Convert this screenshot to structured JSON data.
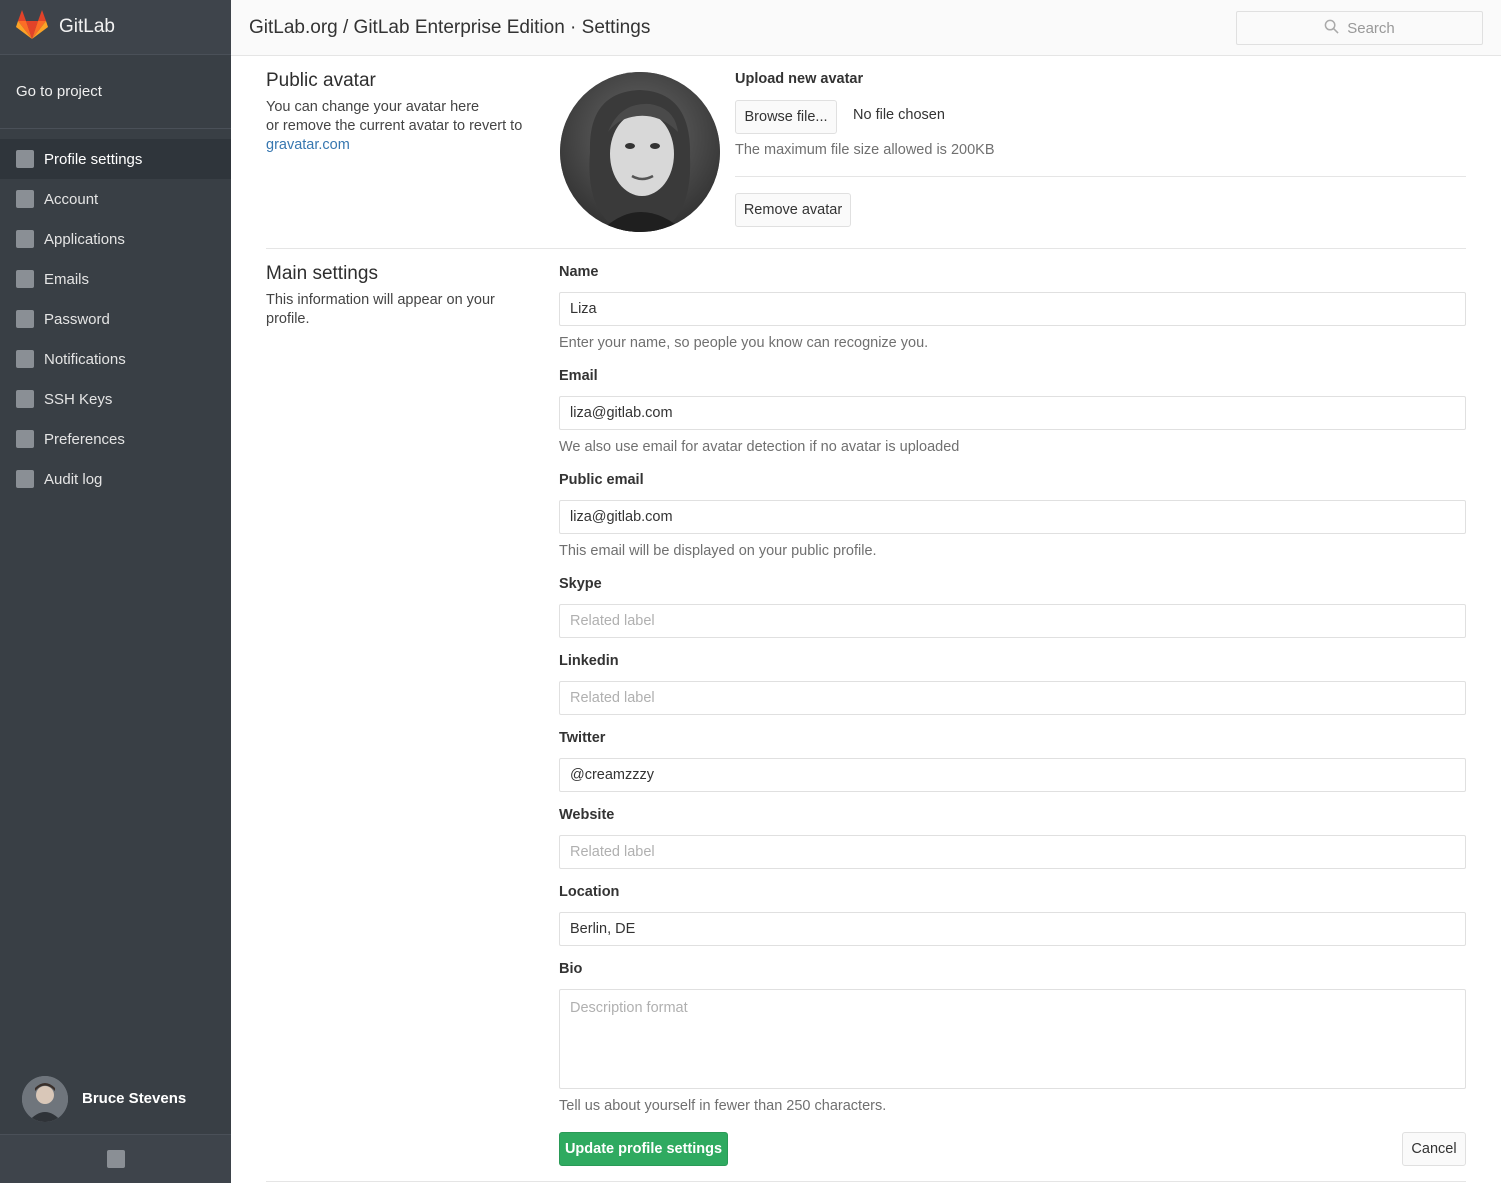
{
  "brand": {
    "name": "GitLab",
    "logo_icon": "gitlab-tanuki-icon"
  },
  "sidebar": {
    "go_to_project": "Go to project",
    "items": [
      {
        "label": "Profile settings",
        "active": true
      },
      {
        "label": "Account"
      },
      {
        "label": "Applications"
      },
      {
        "label": "Emails"
      },
      {
        "label": "Password"
      },
      {
        "label": "Notifications"
      },
      {
        "label": "SSH Keys"
      },
      {
        "label": "Preferences"
      },
      {
        "label": "Audit log"
      }
    ],
    "user": {
      "name": "Bruce Stevens"
    }
  },
  "header": {
    "title": "GitLab.org / GitLab Enterprise Edition · Settings",
    "search_placeholder": "Search"
  },
  "avatar_section": {
    "title": "Public avatar",
    "desc_line1": "You can change your avatar here",
    "desc_line2": "or remove the current avatar to revert to",
    "link": "gravatar.com",
    "upload_label": "Upload new avatar",
    "browse_button": "Browse file...",
    "no_file": "No file chosen",
    "max_size": "The maximum file size allowed is 200KB",
    "remove_button": "Remove avatar"
  },
  "main_section": {
    "title": "Main settings",
    "desc_line1": "This information will appear on your",
    "desc_line2": "profile.",
    "fields": {
      "name": {
        "label": "Name",
        "value": "Liza",
        "help": "Enter your name, so people you know can recognize you."
      },
      "email": {
        "label": "Email",
        "value": "liza@gitlab.com",
        "help": "We also use email for avatar detection if no avatar is uploaded"
      },
      "public_email": {
        "label": "Public email",
        "value": "liza@gitlab.com",
        "help": "This email will be displayed on your public profile."
      },
      "skype": {
        "label": "Skype",
        "value": "",
        "placeholder": "Related label"
      },
      "linkedin": {
        "label": "Linkedin",
        "value": "",
        "placeholder": "Related label"
      },
      "twitter": {
        "label": "Twitter",
        "value": "@creamzzzy"
      },
      "website": {
        "label": "Website",
        "value": "",
        "placeholder": "Related label"
      },
      "location": {
        "label": "Location",
        "value": "Berlin, DE"
      },
      "bio": {
        "label": "Bio",
        "value": "",
        "placeholder": "Description format",
        "help": "Tell us about yourself in fewer than 250 characters."
      }
    },
    "update_button": "Update profile settings",
    "cancel_button": "Cancel"
  },
  "colors": {
    "sidebar_bg": "#393f45",
    "accent_green": "#2faa60",
    "link_blue": "#3777b0"
  }
}
